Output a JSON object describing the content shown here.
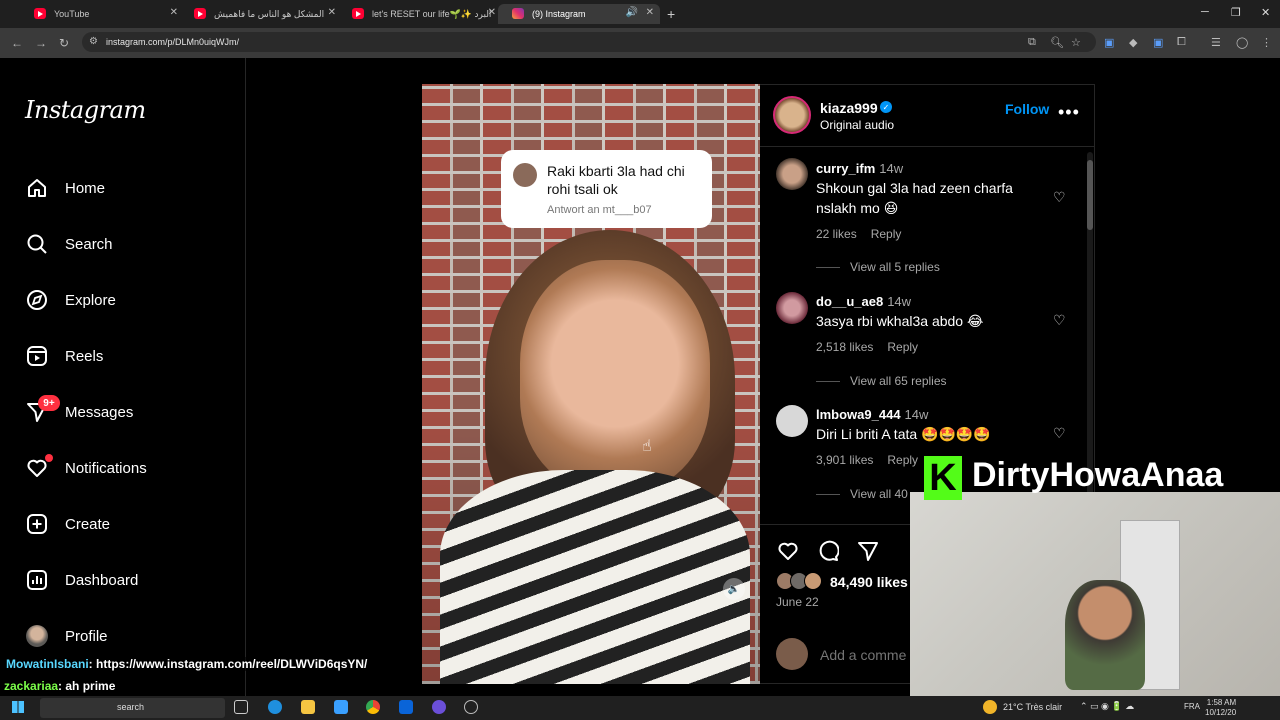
{
  "browser": {
    "tabs": [
      {
        "title": "YouTube",
        "active": false
      },
      {
        "title": "المشكل هو الناس ما فاهميش",
        "active": false
      },
      {
        "title": "let's RESET our life🌱✨ البرد",
        "active": false
      },
      {
        "title": "(9) Instagram",
        "active": true
      }
    ],
    "url": "instagram.com/p/DLMn0uiqWJm/"
  },
  "sidebar": {
    "logo": "Instagram",
    "items": [
      {
        "label": "Home",
        "icon": "home-icon"
      },
      {
        "label": "Search",
        "icon": "search-icon"
      },
      {
        "label": "Explore",
        "icon": "compass-icon"
      },
      {
        "label": "Reels",
        "icon": "reels-icon"
      },
      {
        "label": "Messages",
        "icon": "messenger-icon",
        "badge": "9+"
      },
      {
        "label": "Notifications",
        "icon": "heart-icon"
      },
      {
        "label": "Create",
        "icon": "plus-square-icon"
      },
      {
        "label": "Dashboard",
        "icon": "dashboard-icon"
      },
      {
        "label": "Profile",
        "icon": "profile-avatar"
      }
    ]
  },
  "post": {
    "reply_bubble": {
      "text": "Raki kbarti 3la had chi rohi tsali ok",
      "sub": "Antwort an mt___b07"
    },
    "author": "kiaza999",
    "audio": "Original audio",
    "follow_label": "Follow",
    "comments": [
      {
        "user": "curry_ifm",
        "time": "14w",
        "text": "Shkoun gal 3la had zeen charfa nslakh mo 😆",
        "likes": "22 likes",
        "reply": "Reply",
        "view": "View all 5 replies"
      },
      {
        "user": "do__u_ae8",
        "time": "14w",
        "text": "3asya rbi wkhal3a abdo 😂",
        "likes": "2,518 likes",
        "reply": "Reply",
        "view": "View all 65 replies"
      },
      {
        "user": "lmbowa9_444",
        "time": "14w",
        "text": "Diri Li briti A tata 🤩🤩🤩🤩",
        "likes": "3,901 likes",
        "reply": "Reply",
        "view": "View all 40"
      }
    ],
    "likes_count": "84,490 likes",
    "date": "June 22",
    "comment_placeholder": "Add a comme"
  },
  "stream": {
    "kick_letter": "K",
    "streamer": "DirtyHowaAnaa",
    "chat": [
      {
        "user": "MowatinIsbani",
        "text": ": https://www.instagram.com/reel/DLWViD6qsYN/"
      },
      {
        "user": "zackariaa",
        "text": ": ah prime"
      }
    ]
  },
  "taskbar": {
    "search_placeholder": "search",
    "weather": "21°C Très clair",
    "lang": "FRA",
    "time": "1:58 AM",
    "date": "10/12/20"
  },
  "colors": {
    "accent": "#0095f6",
    "kick": "#53fc18",
    "badge": "#ff3040"
  }
}
